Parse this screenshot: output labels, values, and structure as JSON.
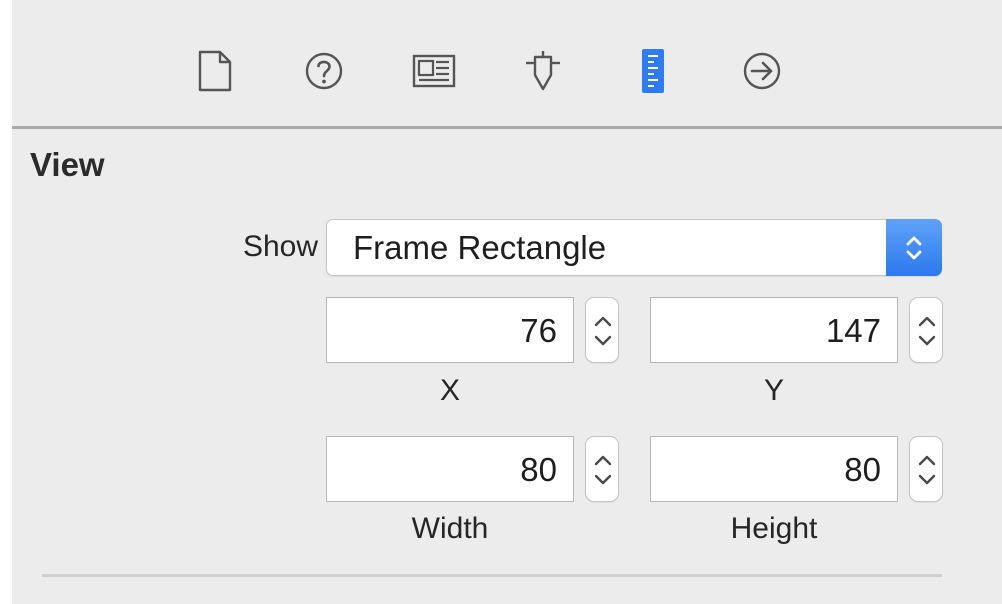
{
  "toolbar": {
    "tabs": [
      {
        "name": "file-inspector",
        "icon": "document-icon",
        "selected": false
      },
      {
        "name": "quick-help-inspector",
        "icon": "help-icon",
        "selected": false
      },
      {
        "name": "identity-inspector",
        "icon": "identity-card-icon",
        "selected": false
      },
      {
        "name": "attributes-inspector",
        "icon": "attributes-icon",
        "selected": false
      },
      {
        "name": "size-inspector",
        "icon": "ruler-icon",
        "selected": true
      },
      {
        "name": "connections-inspector",
        "icon": "arrow-circle-icon",
        "selected": false
      }
    ],
    "accent_color": "#2d7cf6"
  },
  "section": {
    "title": "View"
  },
  "show": {
    "label": "Show",
    "selected": "Frame Rectangle"
  },
  "fields": {
    "x": {
      "value": "76",
      "caption": "X"
    },
    "y": {
      "value": "147",
      "caption": "Y"
    },
    "width": {
      "value": "80",
      "caption": "Width"
    },
    "height": {
      "value": "80",
      "caption": "Height"
    }
  }
}
